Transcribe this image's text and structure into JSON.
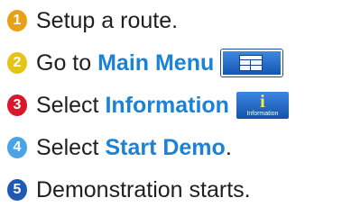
{
  "accent_color": "#1c82d4",
  "steps": [
    {
      "number": "1",
      "color": "#e8a016",
      "text": "Setup a route."
    },
    {
      "number": "2",
      "color": "#e6c31a",
      "before": "Go to ",
      "highlight": "Main Menu",
      "icon": "main-menu-icon"
    },
    {
      "number": "3",
      "color": "#d9182c",
      "before": "Select ",
      "highlight": "Information",
      "icon": "information-icon",
      "icon_label": "Information"
    },
    {
      "number": "4",
      "color": "#4aa3e6",
      "before": "Select ",
      "highlight": "Start Demo",
      "after": "."
    },
    {
      "number": "5",
      "color": "#1f59b4",
      "text": "Demonstration starts."
    }
  ]
}
